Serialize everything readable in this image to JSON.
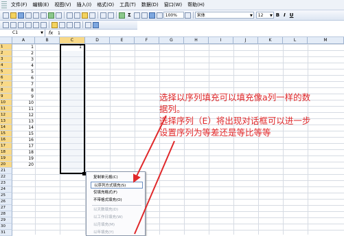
{
  "menubar": {
    "items": [
      "文件(F)",
      "编辑(E)",
      "视图(V)",
      "插入(I)",
      "格式(O)",
      "工具(T)",
      "数据(D)",
      "窗口(W)",
      "帮助(H)"
    ]
  },
  "toolbar": {
    "zoom": "100%",
    "font_name": "宋体",
    "font_size": "12",
    "bold_label": "B",
    "italic_label": "I",
    "underline_label": "U",
    "sigma_label": "Σ"
  },
  "formula_bar": {
    "name_box": "C1",
    "fx_label": "fx",
    "value": "1"
  },
  "sheet": {
    "columns": [
      "A",
      "B",
      "C",
      "D",
      "E",
      "F",
      "G",
      "H",
      "I",
      "J",
      "K",
      "L",
      "M"
    ],
    "selected_column": "C",
    "rows": [
      "1",
      "2",
      "3",
      "4",
      "5",
      "6",
      "7",
      "8",
      "9",
      "10",
      "11",
      "12",
      "13",
      "14",
      "15",
      "16",
      "17",
      "18",
      "19",
      "20",
      "21",
      "22",
      "23",
      "24",
      "25",
      "26",
      "27",
      "28",
      "29",
      "30",
      "31"
    ],
    "column_a_values": [
      "1",
      "2",
      "3",
      "4",
      "5",
      "6",
      "7",
      "8",
      "9",
      "10",
      "11",
      "12",
      "13",
      "14",
      "15",
      "16",
      "17",
      "18",
      "19",
      "20"
    ],
    "c1_value": "1"
  },
  "context_menu": {
    "items": [
      {
        "label": "复制单元格(C)",
        "state": "normal"
      },
      {
        "label": "以序列方式填充(S)",
        "state": "highlighted"
      },
      {
        "label": "仅填充格式(F)",
        "state": "normal"
      },
      {
        "label": "不带格式填充(O)",
        "state": "normal"
      },
      {
        "label": "以天数填充(D)",
        "state": "disabled"
      },
      {
        "label": "以工作日填充(W)",
        "state": "disabled"
      },
      {
        "label": "以月填充(M)",
        "state": "disabled"
      },
      {
        "label": "以年填充(Y)",
        "state": "disabled"
      }
    ]
  },
  "annotation": {
    "lines": [
      "选择以序列填充可以填充像a列一样的数",
      "据列。",
      "选择序列（E）将出现对话框可以进一步",
      "设置序列为等差还是等比等等"
    ],
    "color": "#e0282a"
  }
}
